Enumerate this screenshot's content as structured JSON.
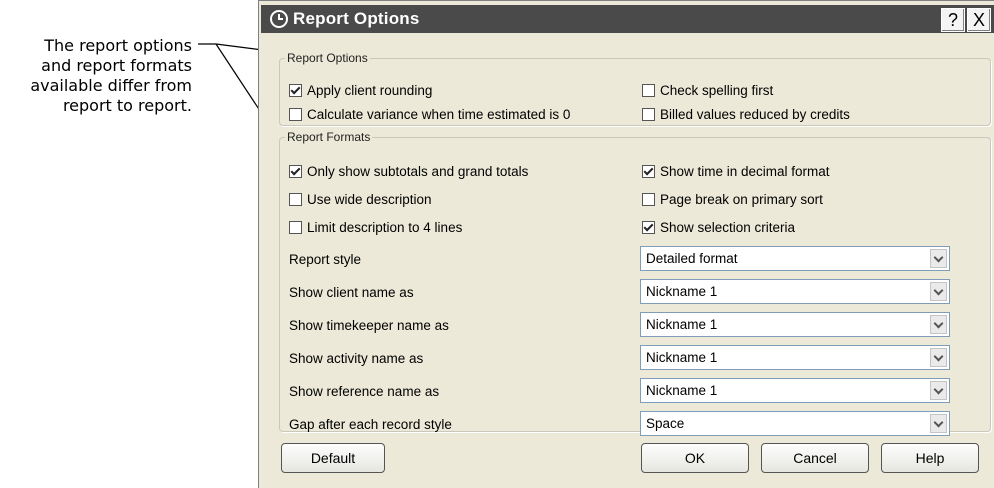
{
  "annotation": {
    "lines": [
      "The report options",
      "and report formats",
      "available differ from",
      "report to report."
    ]
  },
  "dialog": {
    "title": "Report Options",
    "help_label": "?",
    "close_label": "X",
    "title_icon": "clock-icon"
  },
  "report_options": {
    "legend": "Report Options",
    "items": [
      {
        "label": "Apply client rounding",
        "checked": true
      },
      {
        "label": "Check spelling first",
        "checked": false
      },
      {
        "label": "Calculate variance when time estimated is 0",
        "checked": false
      },
      {
        "label": "Billed values reduced by credits",
        "checked": false
      }
    ]
  },
  "report_formats": {
    "legend": "Report Formats",
    "checkboxes": [
      {
        "label": "Only show subtotals and grand totals",
        "checked": true
      },
      {
        "label": "Show time in decimal format",
        "checked": true
      },
      {
        "label": "Use wide description",
        "checked": false
      },
      {
        "label": "Page break on primary sort",
        "checked": false
      },
      {
        "label": "Limit description to 4 lines",
        "checked": false
      },
      {
        "label": "Show selection criteria",
        "checked": true
      }
    ],
    "dropdowns": [
      {
        "label": "Report style",
        "value": "Detailed format"
      },
      {
        "label": "Show client name as",
        "value": "Nickname 1"
      },
      {
        "label": "Show timekeeper name as",
        "value": "Nickname 1"
      },
      {
        "label": "Show activity name as",
        "value": "Nickname 1"
      },
      {
        "label": "Show reference name as",
        "value": "Nickname 1"
      },
      {
        "label": "Gap after each record style",
        "value": "Space"
      }
    ]
  },
  "buttons": {
    "default": "Default",
    "ok": "OK",
    "cancel": "Cancel",
    "help": "Help"
  }
}
